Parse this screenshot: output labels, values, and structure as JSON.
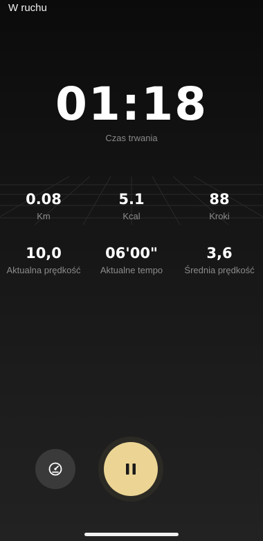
{
  "header": {
    "title": "W ruchu"
  },
  "timer": {
    "value": "01:18",
    "label": "Czas trwania"
  },
  "stats_row1": [
    {
      "value": "0.08",
      "label": "Km"
    },
    {
      "value": "5.1",
      "label": "Kcal"
    },
    {
      "value": "88",
      "label": "Kroki"
    }
  ],
  "stats_row2": [
    {
      "value": "10,0",
      "label": "Aktualna prędkość"
    },
    {
      "value": "06'00\"",
      "label": "Aktualne tempo"
    },
    {
      "value": "3,6",
      "label": "Średnia prędkość"
    }
  ],
  "controls": {
    "speed_icon": "speedometer-icon",
    "pause_icon": "pause-icon",
    "accent_color": "#ecd594"
  }
}
